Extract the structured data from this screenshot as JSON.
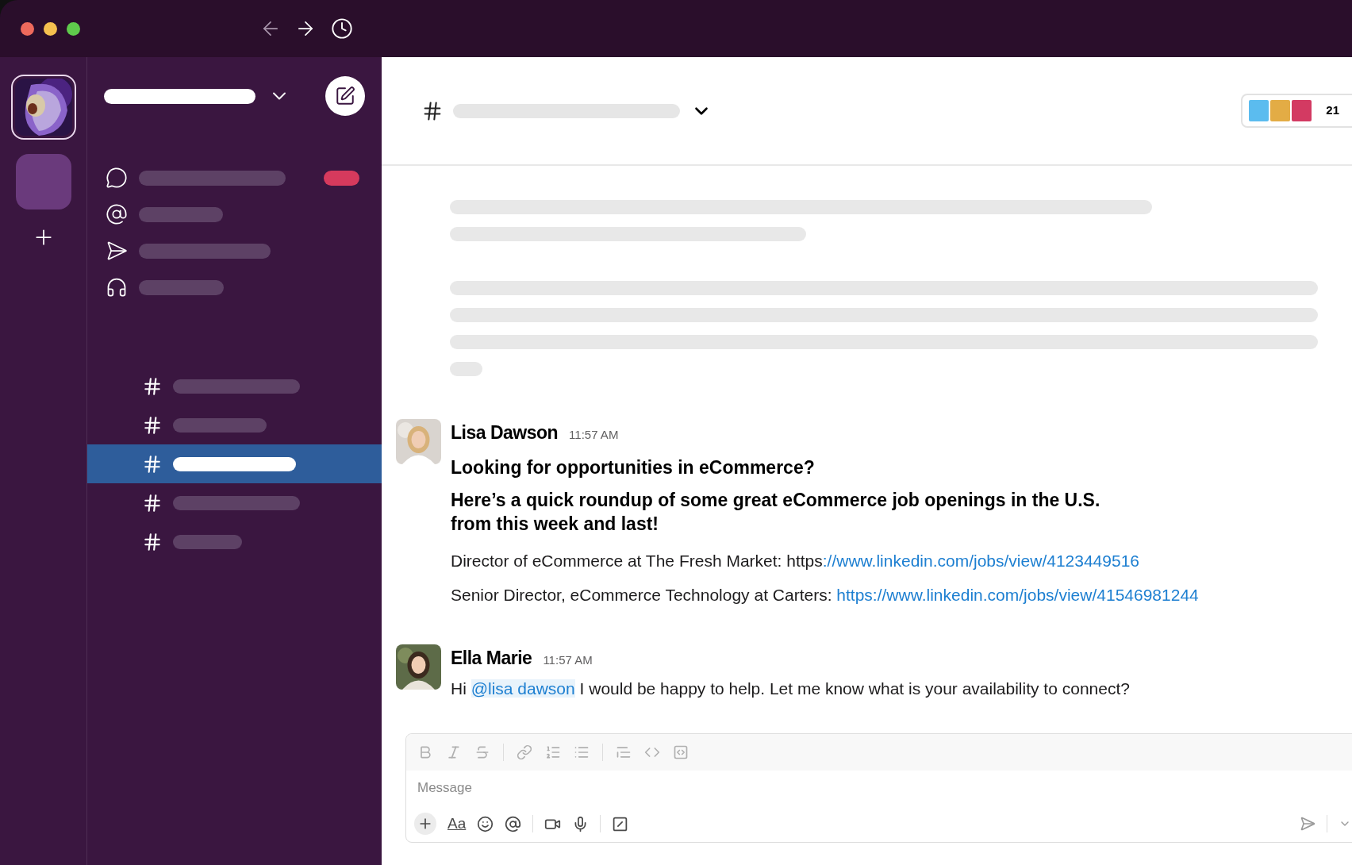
{
  "sidebar": {
    "nav": [
      {
        "kind": "threads",
        "unread": true
      },
      {
        "kind": "mentions",
        "unread": false
      },
      {
        "kind": "sent",
        "unread": false
      },
      {
        "kind": "huddles",
        "unread": false
      }
    ],
    "channels": [
      {
        "selected": false
      },
      {
        "selected": false
      },
      {
        "selected": true
      },
      {
        "selected": false
      },
      {
        "selected": false
      }
    ]
  },
  "header": {
    "member_avatars": [
      {
        "color": "#5bbcef"
      },
      {
        "color": "#e3ac45"
      },
      {
        "color": "#d33a62"
      }
    ],
    "member_count": "21"
  },
  "messages": [
    {
      "author": "Lisa Dawson",
      "time": "11:57 AM",
      "headings": [
        "Looking for opportunities in eCommerce?",
        "Here’s a quick roundup of some great eCommerce job openings in the U.S. from this week and last!"
      ],
      "lines": [
        {
          "text": "Director of eCommerce at The Fresh Market: https",
          "link": "://www.linkedin.com/jobs/view/4123449516"
        },
        {
          "text": "Senior Director, eCommerce Technology at Carters: ",
          "link": "https://www.linkedin.com/jobs/view/41546981244"
        }
      ]
    },
    {
      "author": "Ella Marie",
      "time": "11:57 AM",
      "mention_before": "Hi ",
      "mention": "@lisa dawson",
      "mention_after": " I would be happy to help. Let me know what is your availability to connect?"
    }
  ],
  "composer": {
    "placeholder": "Message",
    "format_label": "Aa"
  }
}
